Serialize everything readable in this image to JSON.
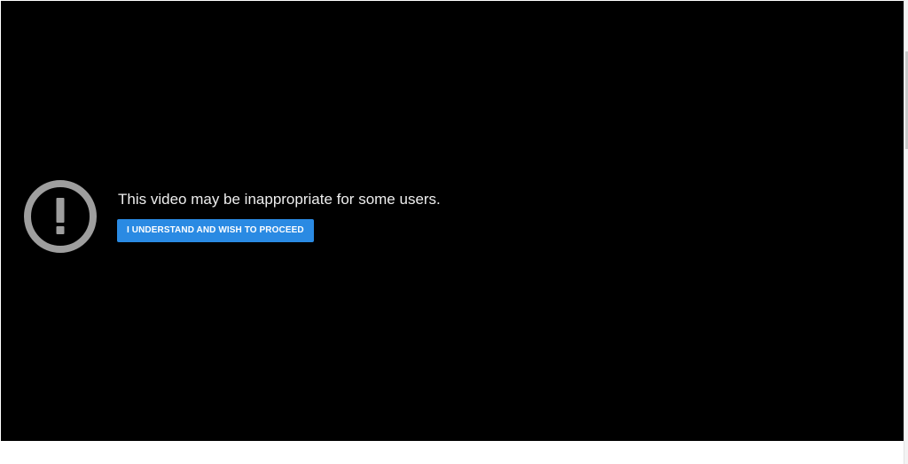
{
  "warning": {
    "message": "This video may be inappropriate for some users.",
    "proceed_label": "I UNDERSTAND AND WISH TO PROCEED",
    "icon": "exclamation-circle-icon"
  },
  "colors": {
    "player_background": "#000000",
    "icon": "#9e9e9e",
    "message_text": "#eeeeee",
    "button_background": "#2a8ae3",
    "button_text": "#ffffff"
  }
}
